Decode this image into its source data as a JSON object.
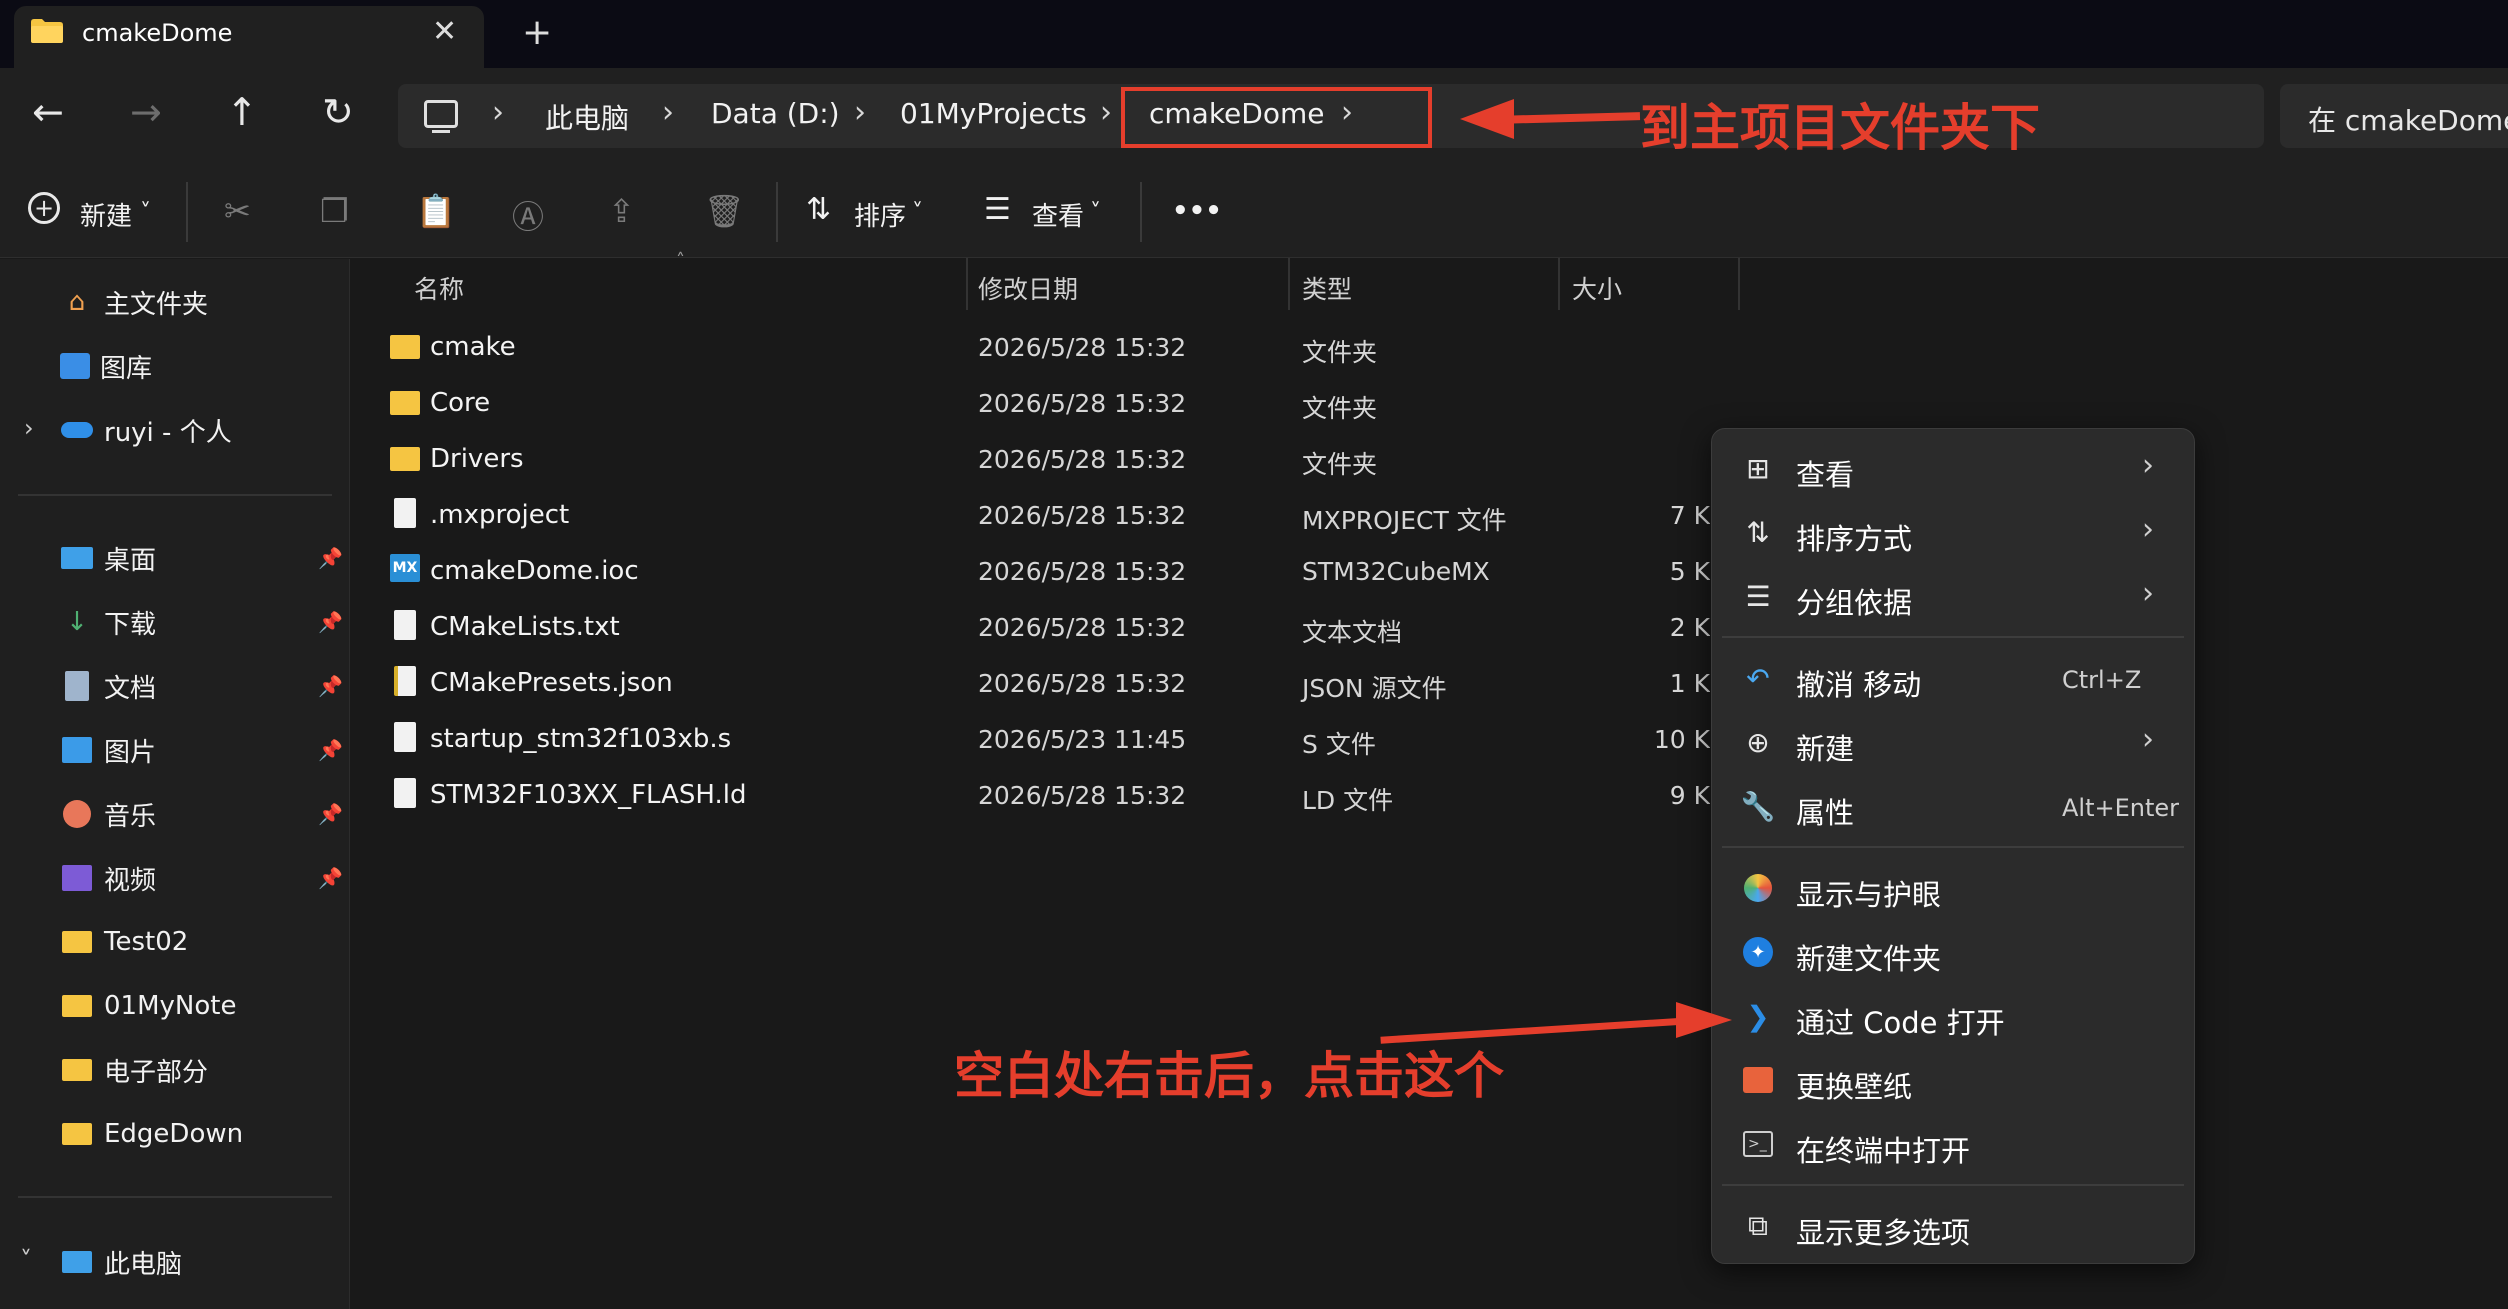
{
  "tab": {
    "title": "cmakeDome",
    "close_glyph": "✕",
    "new_glyph": "+"
  },
  "nav": {
    "back": "←",
    "forward": "→",
    "up": "↑",
    "refresh": "↻",
    "breadcrumbs": [
      "此电脑",
      "Data (D:)",
      "01MyProjects",
      "cmakeDome"
    ],
    "chevron": "›",
    "search_placeholder": "在 cmakeDome"
  },
  "annotations": {
    "top": "到主项目文件夹下",
    "bottom": "空白处右击后，点击这个"
  },
  "toolbar": {
    "new_label": "新建",
    "sort_label": "排序",
    "view_label": "查看",
    "more_label": "•••",
    "caret": "˅"
  },
  "sidebar": {
    "quick": [
      {
        "label": "主文件夹",
        "icon": "home-icon"
      },
      {
        "label": "图库",
        "icon": "gallery-icon"
      },
      {
        "label": "ruyi - 个人",
        "icon": "onedrive-icon"
      }
    ],
    "pinned": [
      {
        "label": "桌面",
        "icon": "desktop-icon"
      },
      {
        "label": "下载",
        "icon": "download-icon"
      },
      {
        "label": "文档",
        "icon": "documents-icon"
      },
      {
        "label": "图片",
        "icon": "pictures-icon"
      },
      {
        "label": "音乐",
        "icon": "music-icon"
      },
      {
        "label": "视频",
        "icon": "videos-icon"
      }
    ],
    "folders": [
      "Test02",
      "01MyNote",
      "电子部分",
      "EdgeDown"
    ],
    "this_pc": "此电脑"
  },
  "columns": {
    "name": "名称",
    "date": "修改日期",
    "type": "类型",
    "size": "大小"
  },
  "files": [
    {
      "name": "cmake",
      "date": "2026/5/28 15:32",
      "type": "文件夹",
      "size": "",
      "icon": "folder-icon"
    },
    {
      "name": "Core",
      "date": "2026/5/28 15:32",
      "type": "文件夹",
      "size": "",
      "icon": "folder-icon"
    },
    {
      "name": "Drivers",
      "date": "2026/5/28 15:32",
      "type": "文件夹",
      "size": "",
      "icon": "folder-icon"
    },
    {
      "name": ".mxproject",
      "date": "2026/5/28 15:32",
      "type": "MXPROJECT 文件",
      "size": "7 K",
      "icon": "file-icon"
    },
    {
      "name": "cmakeDome.ioc",
      "date": "2026/5/28 15:32",
      "type": "STM32CubeMX",
      "size": "5 K",
      "icon": "cubemx-icon"
    },
    {
      "name": "CMakeLists.txt",
      "date": "2026/5/28 15:32",
      "type": "文本文档",
      "size": "2 K",
      "icon": "text-file-icon"
    },
    {
      "name": "CMakePresets.json",
      "date": "2026/5/28 15:32",
      "type": "JSON 源文件",
      "size": "1 K",
      "icon": "json-file-icon"
    },
    {
      "name": "startup_stm32f103xb.s",
      "date": "2026/5/23 11:45",
      "type": "S 文件",
      "size": "10 K",
      "icon": "file-icon"
    },
    {
      "name": "STM32F103XX_FLASH.ld",
      "date": "2026/5/28 15:32",
      "type": "LD 文件",
      "size": "9 K",
      "icon": "file-icon"
    }
  ],
  "context_menu": {
    "view": "查看",
    "sort": "排序方式",
    "group": "分组依据",
    "undo": "撤消 移动",
    "undo_shortcut": "Ctrl+Z",
    "new": "新建",
    "properties": "属性",
    "properties_shortcut": "Alt+Enter",
    "display": "显示与护眼",
    "new_folder": "新建文件夹",
    "open_code": "通过 Code 打开",
    "wallpaper": "更换壁纸",
    "terminal": "在终端中打开",
    "more": "显示更多选项"
  },
  "colors": {
    "accent_annotation": "#e53e2c",
    "folder": "#f5c542",
    "background": "#191919"
  }
}
